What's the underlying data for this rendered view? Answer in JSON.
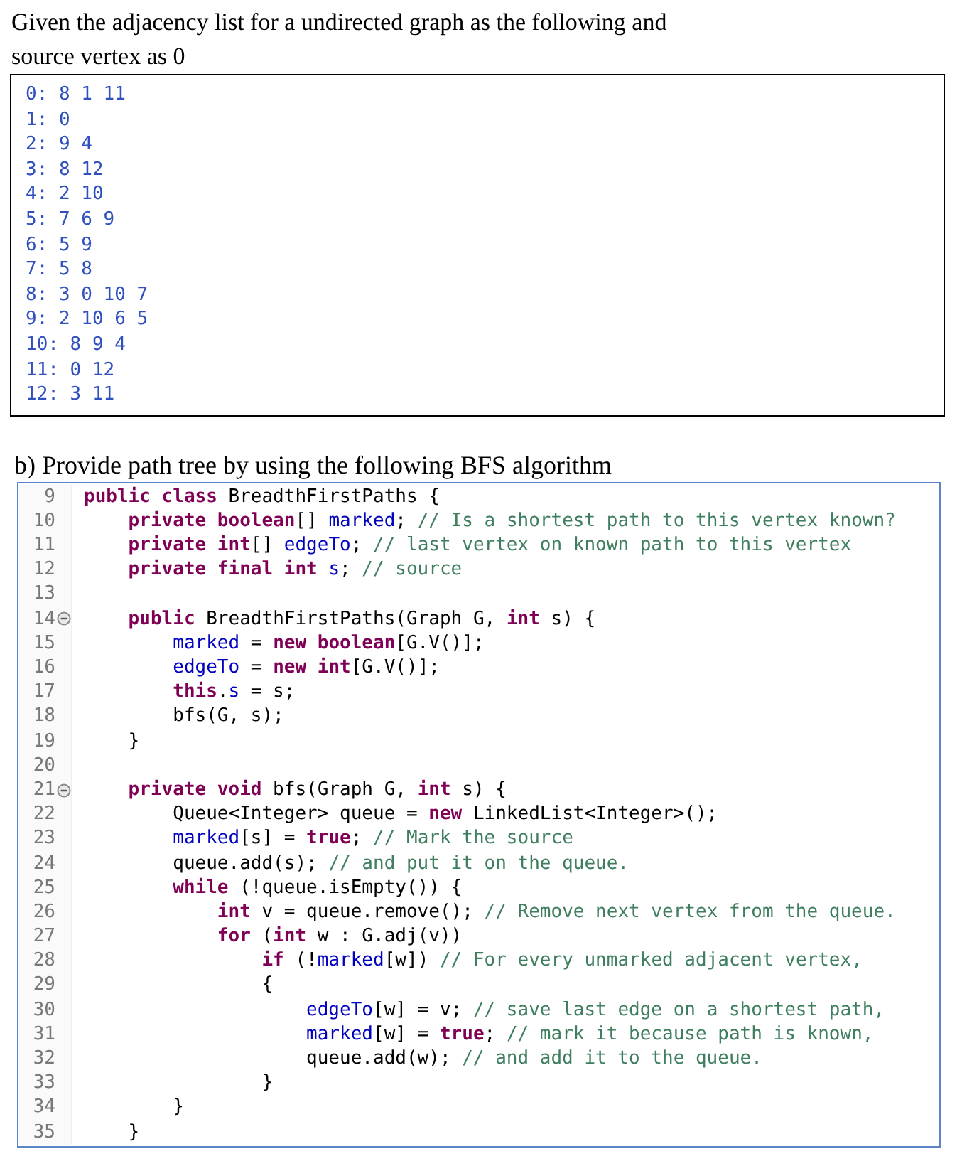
{
  "question": {
    "lines": [
      "Given the adjacency list for a undirected graph as the following and",
      "source vertex as 0"
    ]
  },
  "adjacency_list": [
    "0: 8 1 11",
    "1: 0",
    "2: 9 4",
    "3: 8 12",
    "4: 2 10",
    "5: 7 6 9",
    "6: 5 9",
    "7: 5 8",
    "8: 3 0 10 7",
    "9: 2 10 6 5",
    "10: 8 9 4",
    "11: 0 12",
    "12: 3 11"
  ],
  "part_b": {
    "heading": "b) Provide path tree by using the following BFS algorithm"
  },
  "code_lines": [
    {
      "number": "9",
      "fold": false,
      "tokens": [
        {
          "kind": "kw",
          "text": "public class"
        },
        {
          "kind": "text",
          "text": " BreadthFirstPaths {"
        }
      ]
    },
    {
      "number": "10",
      "fold": false,
      "tokens": [
        {
          "kind": "kw",
          "text": "    private boolean"
        },
        {
          "kind": "text",
          "text": "[] "
        },
        {
          "kind": "field",
          "text": "marked"
        },
        {
          "kind": "text",
          "text": "; "
        },
        {
          "kind": "comment",
          "text": "// Is a shortest path to this vertex known?"
        }
      ]
    },
    {
      "number": "11",
      "fold": false,
      "tokens": [
        {
          "kind": "kw",
          "text": "    private int"
        },
        {
          "kind": "text",
          "text": "[] "
        },
        {
          "kind": "field",
          "text": "edgeTo"
        },
        {
          "kind": "text",
          "text": "; "
        },
        {
          "kind": "comment",
          "text": "// last vertex on known path to this vertex"
        }
      ]
    },
    {
      "number": "12",
      "fold": false,
      "tokens": [
        {
          "kind": "kw",
          "text": "    private final int "
        },
        {
          "kind": "field",
          "text": "s"
        },
        {
          "kind": "text",
          "text": "; "
        },
        {
          "kind": "comment",
          "text": "// source"
        }
      ]
    },
    {
      "number": "13",
      "fold": false
    },
    {
      "number": "14",
      "fold": true,
      "tokens": [
        {
          "kind": "kw",
          "text": "    public"
        },
        {
          "kind": "text",
          "text": " BreadthFirstPaths(Graph G, "
        },
        {
          "kind": "kw",
          "text": "int"
        },
        {
          "kind": "text",
          "text": " s) {"
        }
      ]
    },
    {
      "number": "15",
      "fold": false,
      "tokens": [
        {
          "kind": "field",
          "text": "        marked"
        },
        {
          "kind": "text",
          "text": " = "
        },
        {
          "kind": "kw",
          "text": "new boolean"
        },
        {
          "kind": "text",
          "text": "[G.V()];"
        }
      ]
    },
    {
      "number": "16",
      "fold": false,
      "tokens": [
        {
          "kind": "field",
          "text": "        edgeTo"
        },
        {
          "kind": "text",
          "text": " = "
        },
        {
          "kind": "kw",
          "text": "new int"
        },
        {
          "kind": "text",
          "text": "[G.V()];"
        }
      ]
    },
    {
      "number": "17",
      "fold": false,
      "tokens": [
        {
          "kind": "kw",
          "text": "        this"
        },
        {
          "kind": "text",
          "text": "."
        },
        {
          "kind": "field",
          "text": "s"
        },
        {
          "kind": "text",
          "text": " = s;"
        }
      ]
    },
    {
      "number": "18",
      "fold": false,
      "tokens": [
        {
          "kind": "text",
          "text": "        bfs(G, s);"
        }
      ]
    },
    {
      "number": "19",
      "fold": false,
      "tokens": [
        {
          "kind": "text",
          "text": "    }"
        }
      ]
    },
    {
      "number": "20",
      "fold": false
    },
    {
      "number": "21",
      "fold": true,
      "tokens": [
        {
          "kind": "kw",
          "text": "    private void"
        },
        {
          "kind": "text",
          "text": " bfs(Graph G, "
        },
        {
          "kind": "kw",
          "text": "int"
        },
        {
          "kind": "text",
          "text": " s) {"
        }
      ]
    },
    {
      "number": "22",
      "fold": false,
      "tokens": [
        {
          "kind": "text",
          "text": "        Queue<Integer> queue = "
        },
        {
          "kind": "kw",
          "text": "new"
        },
        {
          "kind": "text",
          "text": " LinkedList<Integer>();"
        }
      ]
    },
    {
      "number": "23",
      "fold": false,
      "tokens": [
        {
          "kind": "field",
          "text": "        marked"
        },
        {
          "kind": "text",
          "text": "[s] = "
        },
        {
          "kind": "kw",
          "text": "true"
        },
        {
          "kind": "text",
          "text": "; "
        },
        {
          "kind": "comment",
          "text": "// Mark the source"
        }
      ]
    },
    {
      "number": "24",
      "fold": false,
      "tokens": [
        {
          "kind": "text",
          "text": "        queue.add(s); "
        },
        {
          "kind": "comment",
          "text": "// and put it on the queue."
        }
      ]
    },
    {
      "number": "25",
      "fold": false,
      "tokens": [
        {
          "kind": "kw",
          "text": "        while"
        },
        {
          "kind": "text",
          "text": " (!queue.isEmpty()) {"
        }
      ]
    },
    {
      "number": "26",
      "fold": false,
      "tokens": [
        {
          "kind": "kw",
          "text": "            int"
        },
        {
          "kind": "text",
          "text": " v = queue.remove(); "
        },
        {
          "kind": "comment",
          "text": "// Remove next vertex from the queue."
        }
      ]
    },
    {
      "number": "27",
      "fold": false,
      "tokens": [
        {
          "kind": "kw",
          "text": "            for"
        },
        {
          "kind": "text",
          "text": " ("
        },
        {
          "kind": "kw",
          "text": "int"
        },
        {
          "kind": "text",
          "text": " w : G.adj(v))"
        }
      ]
    },
    {
      "number": "28",
      "fold": false,
      "tokens": [
        {
          "kind": "kw",
          "text": "                if"
        },
        {
          "kind": "text",
          "text": " (!"
        },
        {
          "kind": "field",
          "text": "marked"
        },
        {
          "kind": "text",
          "text": "[w]) "
        },
        {
          "kind": "comment",
          "text": "// For every unmarked adjacent vertex,"
        }
      ]
    },
    {
      "number": "29",
      "fold": false,
      "tokens": [
        {
          "kind": "text",
          "text": "                {"
        }
      ]
    },
    {
      "number": "30",
      "fold": false,
      "tokens": [
        {
          "kind": "field",
          "text": "                    edgeTo"
        },
        {
          "kind": "text",
          "text": "[w] = v; "
        },
        {
          "kind": "comment",
          "text": "// save last edge on a shortest path,"
        }
      ]
    },
    {
      "number": "31",
      "fold": false,
      "tokens": [
        {
          "kind": "field",
          "text": "                    marked"
        },
        {
          "kind": "text",
          "text": "[w] = "
        },
        {
          "kind": "kw",
          "text": "true"
        },
        {
          "kind": "text",
          "text": "; "
        },
        {
          "kind": "comment",
          "text": "// mark it because path is known,"
        }
      ]
    },
    {
      "number": "32",
      "fold": false,
      "tokens": [
        {
          "kind": "text",
          "text": "                    queue.add(w); "
        },
        {
          "kind": "comment",
          "text": "// and add it to the queue."
        }
      ]
    },
    {
      "number": "33",
      "fold": false,
      "tokens": [
        {
          "kind": "text",
          "text": "                }"
        }
      ]
    },
    {
      "number": "34",
      "fold": false,
      "tokens": [
        {
          "kind": "text",
          "text": "        }"
        }
      ]
    },
    {
      "number": "35",
      "fold": false,
      "tokens": [
        {
          "kind": "text",
          "text": "    }"
        }
      ]
    }
  ]
}
